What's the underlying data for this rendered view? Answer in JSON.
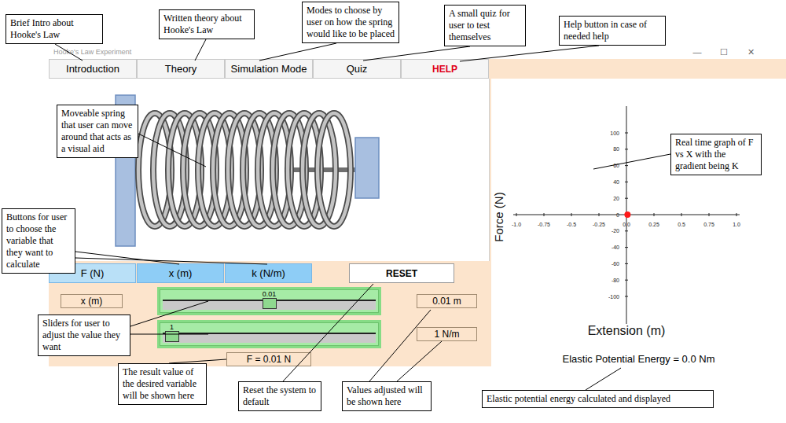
{
  "window": {
    "title": "Hooke's Law Experiment",
    "controls": [
      "—",
      "☐",
      "✕"
    ]
  },
  "menu": [
    {
      "label": "Introduction",
      "kind": "normal"
    },
    {
      "label": "Theory",
      "kind": "normal"
    },
    {
      "label": "Simulation Mode",
      "kind": "normal"
    },
    {
      "label": "Quiz",
      "kind": "normal"
    },
    {
      "label": "HELP",
      "kind": "help"
    }
  ],
  "variable_buttons": [
    {
      "label": "F (N)",
      "selected": true
    },
    {
      "label": "x (m)",
      "selected": false
    },
    {
      "label": "k (N/m)",
      "selected": false
    }
  ],
  "reset": "RESET",
  "sliders": [
    {
      "label": "x (m)",
      "thumb_label": "0.01",
      "level": 0.5,
      "reading": "0.01 m"
    },
    {
      "thumb_label": "1",
      "level": 0.01,
      "reading": "1 N/m"
    }
  ],
  "result": "F = 0.01 N",
  "chart": {
    "y_title": "Force (N)",
    "x_title": "Extension (m)",
    "x_ticks": [
      "-1.0",
      "-0.75",
      "-0.5",
      "-0.25",
      "0.0",
      "0.25",
      "0.5",
      "0.75",
      "1.0"
    ],
    "y_ticks": [
      "100",
      "80",
      "60",
      "40",
      "20",
      "0",
      "-20",
      "-40",
      "-60",
      "-80",
      "-100"
    ],
    "points": [
      {
        "x": 0.01,
        "y": 0.01
      }
    ]
  },
  "energy": "Elastic Potential Energy = 0.0 Nm",
  "annotations": [
    {
      "text": "Brief Intro about Hooke's Law"
    },
    {
      "text": "Written theory about Hooke's Law"
    },
    {
      "text": "Modes to choose by user on how the spring would like to be placed"
    },
    {
      "text": "A small quiz for user to test themselves"
    },
    {
      "text": "Help button in case of needed help"
    },
    {
      "text": "Moveable spring that user can move around that acts as a visual aid"
    },
    {
      "text": "Real time graph of F vs X with the gradient being K"
    },
    {
      "text": "Buttons for user to choose the variable that they want to calculate"
    },
    {
      "text": "Sliders for user to adjust the value they want"
    },
    {
      "text": "The result value of the desired variable will be shown here"
    },
    {
      "text": "Reset the system to default"
    },
    {
      "text": "Values adjusted will be shown here"
    },
    {
      "text": "Elastic potential energy calculated and displayed"
    }
  ]
}
